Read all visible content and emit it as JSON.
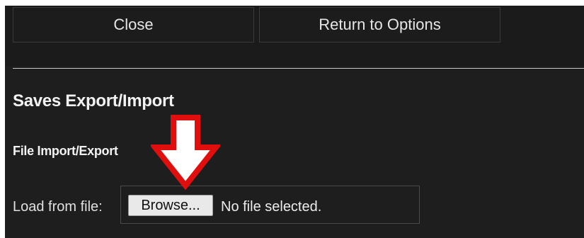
{
  "toolbar": {
    "close_label": "Close",
    "return_label": "Return to Options"
  },
  "saves": {
    "section_title": "Saves Export/Import",
    "subsection_title": "File Import/Export",
    "load_label": "Load from file:",
    "browse_label": "Browse...",
    "file_status": "No file selected."
  },
  "colors": {
    "background": "#1e1e1e",
    "arrow": "#e10e0e"
  },
  "annotation": {
    "icon": "down-arrow-icon"
  }
}
